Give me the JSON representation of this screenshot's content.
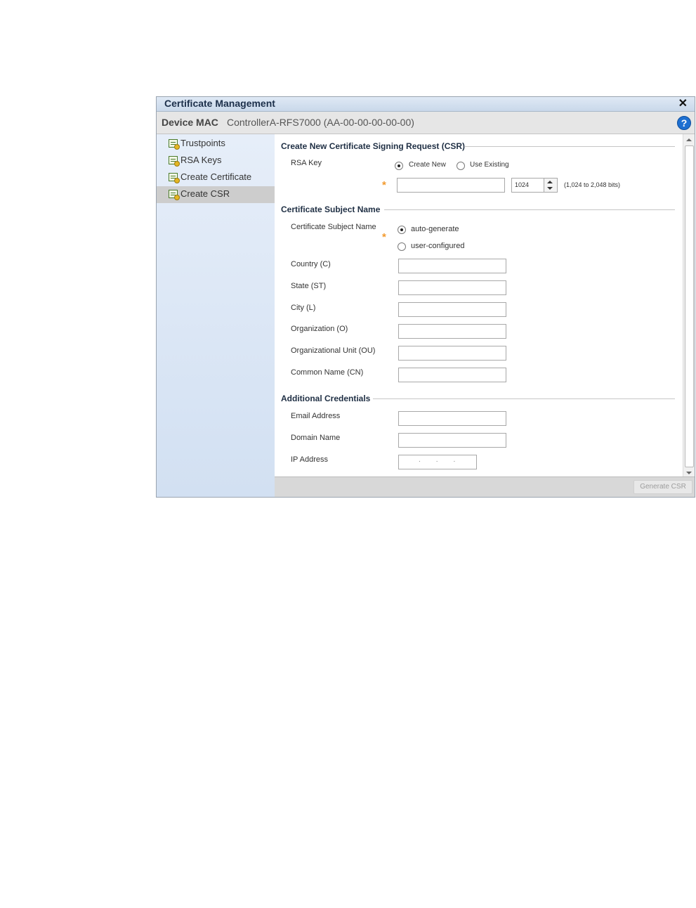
{
  "window": {
    "title": "Certificate Management",
    "close_icon": "close-icon"
  },
  "device": {
    "label": "Device MAC",
    "value": "ControllerA-RFS7000 (AA-00-00-00-00-00)",
    "help_glyph": "?"
  },
  "sidebar": {
    "items": [
      {
        "label": "Trustpoints",
        "selected": false
      },
      {
        "label": "RSA Keys",
        "selected": false
      },
      {
        "label": "Create Certificate",
        "selected": false
      },
      {
        "label": "Create CSR",
        "selected": true
      }
    ]
  },
  "csr": {
    "heading": "Create New Certificate Signing Request (CSR)",
    "rsa_key_label": "RSA Key",
    "option_create_new": "Create New",
    "option_use_existing": "Use Existing",
    "key_size_value": "1024",
    "key_size_hint": "(1,024 to 2,048 bits)",
    "required_marker": "*"
  },
  "subject": {
    "heading": "Certificate Subject Name",
    "label": "Certificate Subject Name",
    "option_auto": "auto-generate",
    "option_user": "user-configured",
    "required_marker": "*",
    "fields": {
      "country": "Country (C)",
      "state": "State (ST)",
      "city": "City (L)",
      "organization": "Organization (O)",
      "org_unit": "Organizational Unit (OU)",
      "common_name": "Common Name (CN)"
    }
  },
  "additional": {
    "heading": "Additional Credentials",
    "email": "Email Address",
    "domain": "Domain Name",
    "ip": "IP Address",
    "ip_dots": "..."
  },
  "footer": {
    "generate_label": "Generate CSR"
  },
  "colors": {
    "accent": "#1d6fd1",
    "required": "#f29a2e",
    "sidebar": "#dbe6f5"
  }
}
